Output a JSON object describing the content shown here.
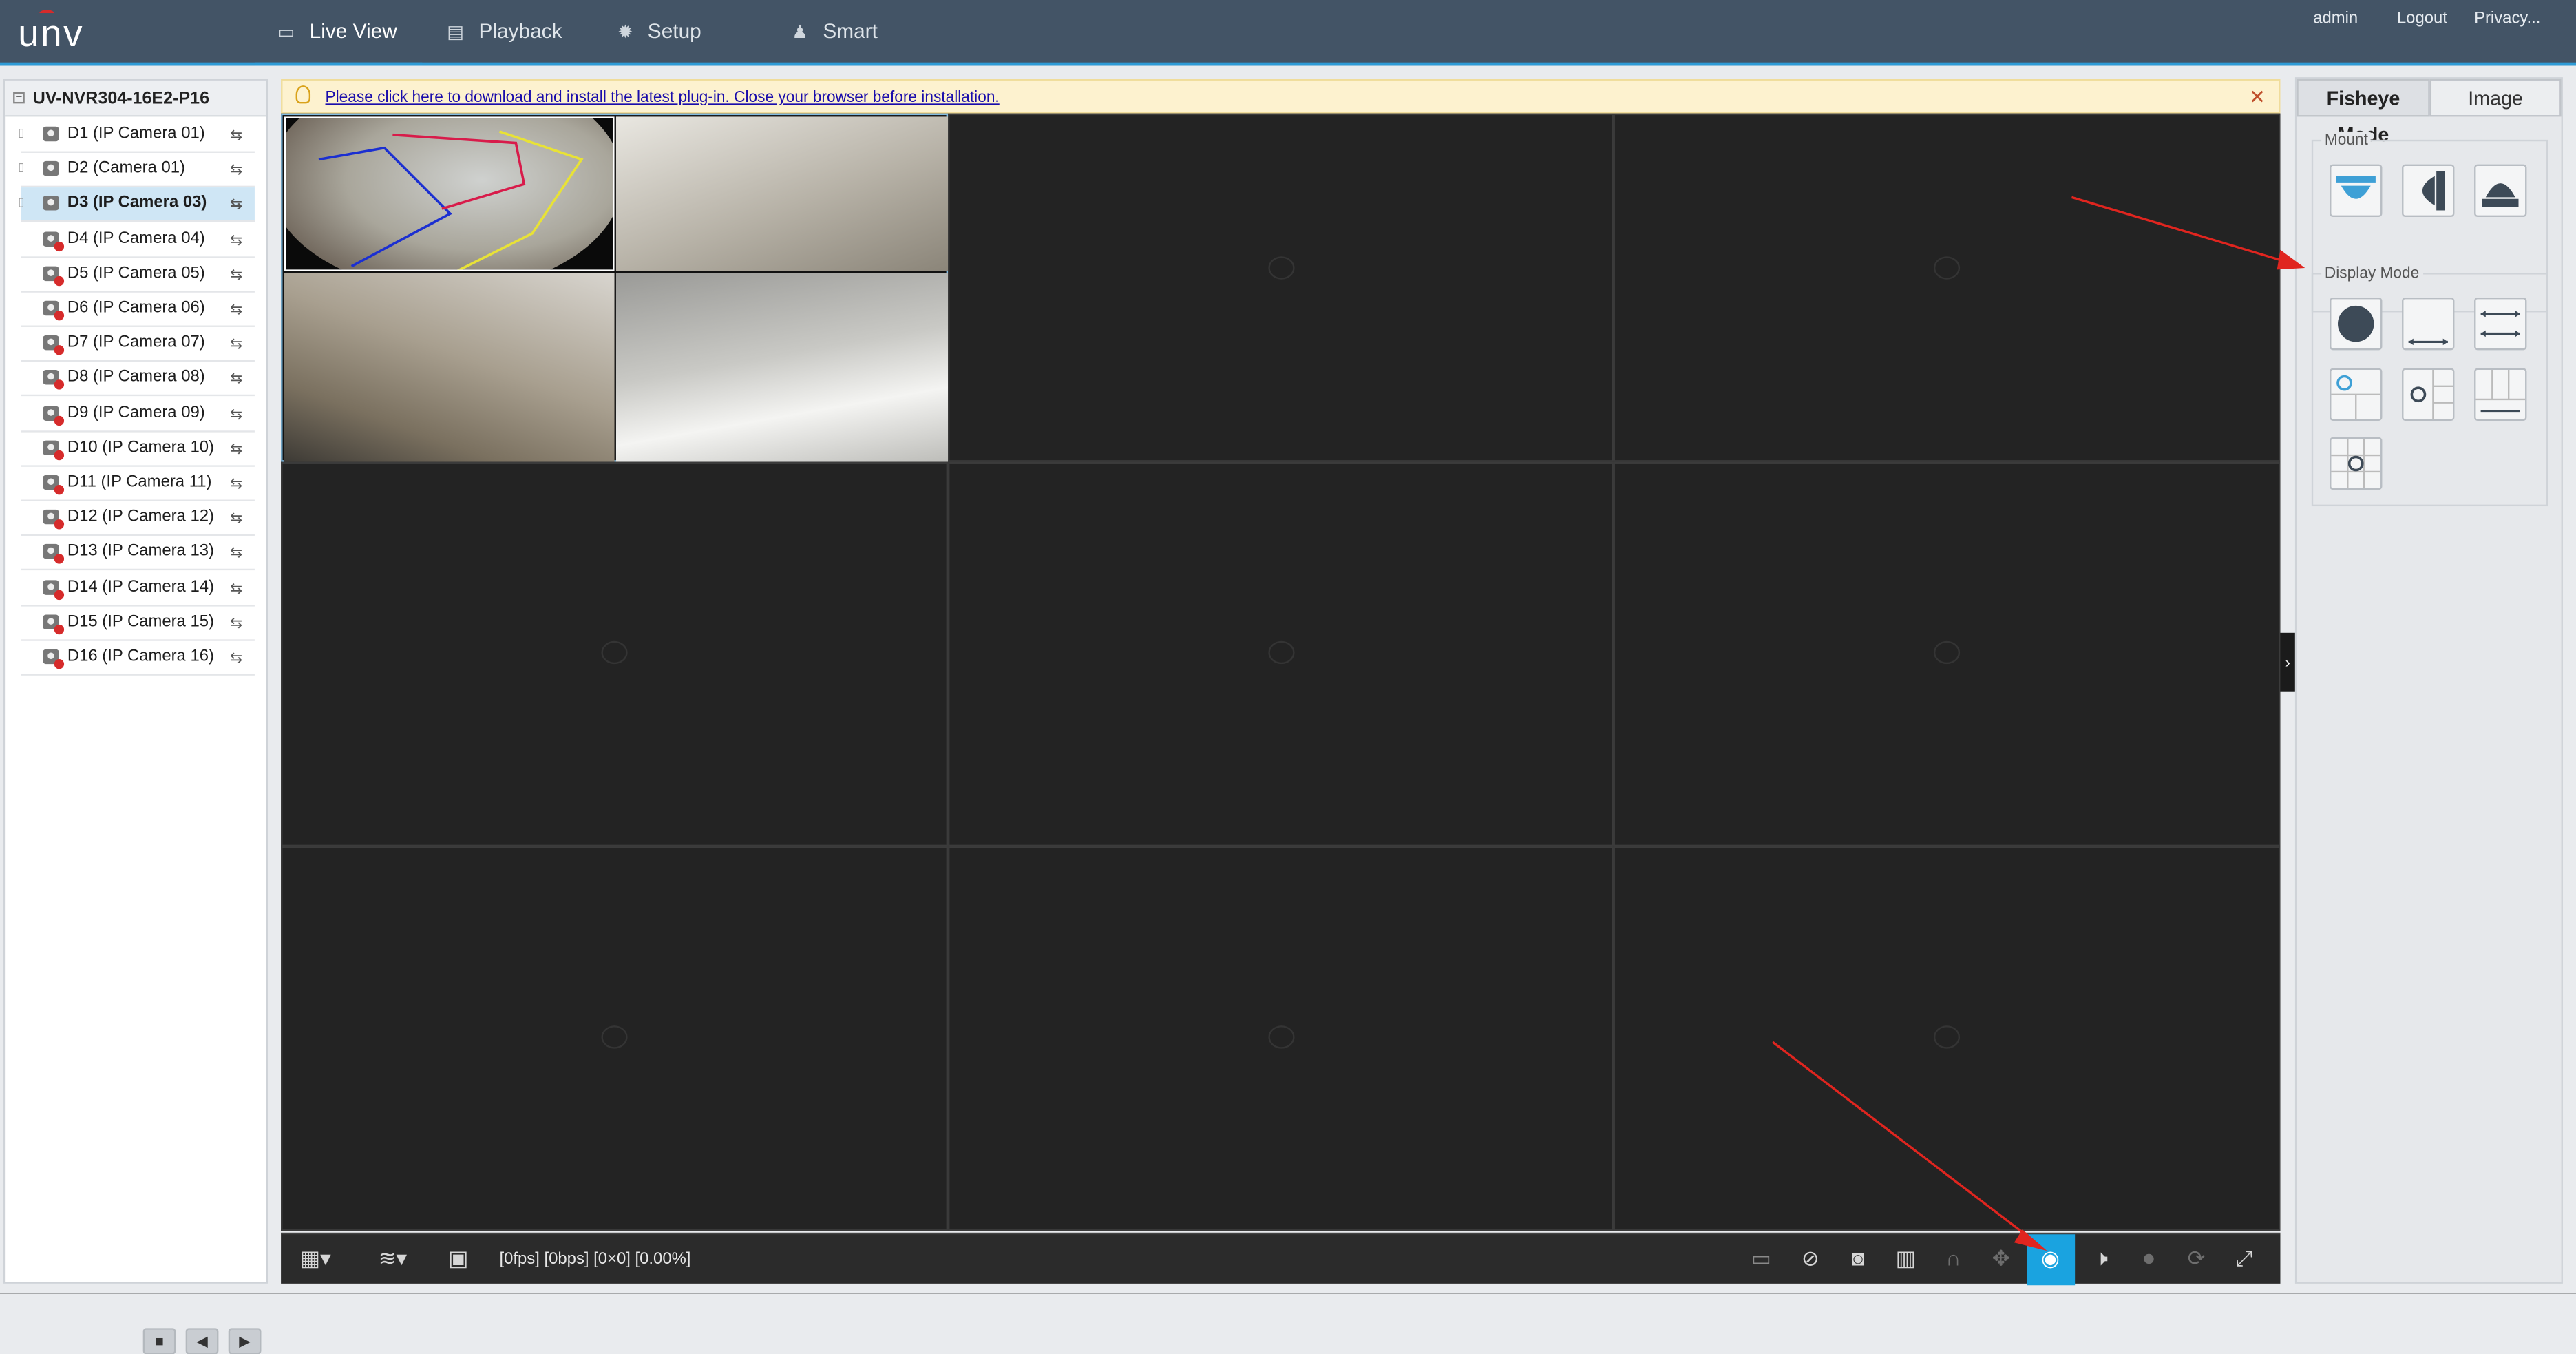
{
  "brand": {
    "logo": "unv"
  },
  "nav": {
    "items": [
      {
        "label": "Live View",
        "active": true
      },
      {
        "label": "Playback",
        "active": false
      },
      {
        "label": "Setup",
        "active": false
      },
      {
        "label": "Smart",
        "active": false
      }
    ]
  },
  "user_links": {
    "user": "admin",
    "logout": "Logout",
    "privacy": "Privacy..."
  },
  "device": {
    "name": "UV-NVR304-16E2-P16"
  },
  "cameras": [
    {
      "label": "D1 (IP Camera 01)",
      "status": "online",
      "selected": false
    },
    {
      "label": "D2 (Camera 01)",
      "status": "online",
      "selected": false
    },
    {
      "label": "D3 (IP Camera 03)",
      "status": "online",
      "selected": true
    },
    {
      "label": "D4 (IP Camera 04)",
      "status": "offline",
      "selected": false
    },
    {
      "label": "D5 (IP Camera 05)",
      "status": "offline",
      "selected": false
    },
    {
      "label": "D6 (IP Camera 06)",
      "status": "offline",
      "selected": false
    },
    {
      "label": "D7 (IP Camera 07)",
      "status": "offline",
      "selected": false
    },
    {
      "label": "D8 (IP Camera 08)",
      "status": "offline",
      "selected": false
    },
    {
      "label": "D9 (IP Camera 09)",
      "status": "offline",
      "selected": false
    },
    {
      "label": "D10 (IP Camera 10)",
      "status": "offline",
      "selected": false
    },
    {
      "label": "D11 (IP Camera 11)",
      "status": "offline",
      "selected": false
    },
    {
      "label": "D12 (IP Camera 12)",
      "status": "offline",
      "selected": false
    },
    {
      "label": "D13 (IP Camera 13)",
      "status": "offline",
      "selected": false
    },
    {
      "label": "D14 (IP Camera 14)",
      "status": "offline",
      "selected": false
    },
    {
      "label": "D15 (IP Camera 15)",
      "status": "offline",
      "selected": false
    },
    {
      "label": "D16 (IP Camera 16)",
      "status": "offline",
      "selected": false
    }
  ],
  "notice": {
    "text": "Please click here to download and install the latest plug-in. Close your browser before installation."
  },
  "toolbar": {
    "status": "[0fps] [0bps] [0×0] [0.00%]"
  },
  "fisheye_panel": {
    "tabs": [
      {
        "label": "Fisheye Mode",
        "active": true
      },
      {
        "label": "Image",
        "active": false
      }
    ],
    "mount_title": "Mount",
    "display_mode_title": "Display Mode"
  },
  "icons": [
    "monitor-icon",
    "playback-icon",
    "gear-icon",
    "smart-icon",
    "grid-layout-icon",
    "stream-type-icon",
    "lock-icon",
    "stop-icon",
    "prev-icon",
    "next-icon",
    "fisheye-icon",
    "audio-icon",
    "mic-icon",
    "zoom-icon",
    "fullscreen-icon",
    "snapshot-icon",
    "record-icon"
  ],
  "colors": {
    "header_bg": "#435466",
    "accent": "#2e9bd6",
    "active_tool": "#1aa3e0",
    "error": "#d62b2b"
  }
}
